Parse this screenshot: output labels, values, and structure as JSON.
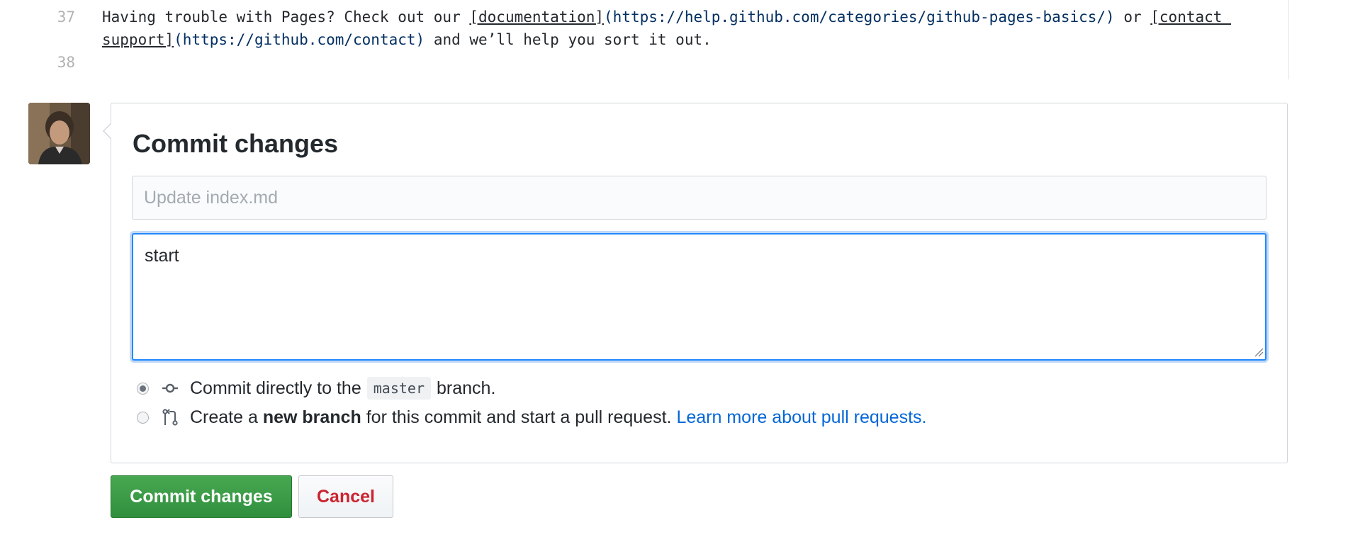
{
  "editor": {
    "lines": [
      {
        "number": "37",
        "text_before": "Having trouble with Pages? Check out our ",
        "link1_text": "[documentation]",
        "link1_url": "(https://help.github.com/categories/github-pages-basics/)",
        "middle": " or ",
        "link2_text_a": "[contact ",
        "link2_text_b": "support]",
        "link2_url": "(https://github.com/contact)",
        "text_after": " and we’ll help you sort it out."
      },
      {
        "number": "38",
        "text": ""
      }
    ]
  },
  "commit": {
    "title": "Commit changes",
    "summary_placeholder": "Update index.md",
    "summary_value": "",
    "description_value": "start",
    "options": [
      {
        "selected": true,
        "icon": "git-commit-icon",
        "prefix": "Commit directly to the",
        "branch": "master",
        "suffix": "branch."
      },
      {
        "selected": false,
        "icon": "git-pull-request-icon",
        "prefix": "Create a",
        "bold": "new branch",
        "suffix": "for this commit and start a pull request.",
        "link": "Learn more about pull requests."
      }
    ],
    "buttons": {
      "commit": "Commit changes",
      "cancel": "Cancel"
    }
  },
  "colors": {
    "primary_button": "#2f8f3d",
    "danger_text": "#cb2431",
    "link": "#0366d6",
    "focus": "#2188ff"
  }
}
